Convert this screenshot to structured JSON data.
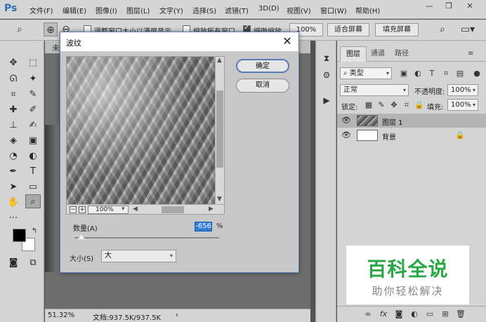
{
  "app": {
    "logo": "Ps",
    "menu": [
      "文件(F)",
      "编辑(E)",
      "图像(I)",
      "图层(L)",
      "文字(Y)",
      "选择(S)",
      "滤镜(T)",
      "3D(D)",
      "视图(V)",
      "窗口(W)",
      "帮助(H)"
    ],
    "window_controls": [
      "—",
      "❐",
      "✕"
    ]
  },
  "options_bar": {
    "resize_windows_label": "调整窗口大小以满屏显示",
    "zoom_all_label": "缩放所有窗口",
    "scrubby_zoom_label": "细微缩放",
    "zoom_value": "100%",
    "fit_screen": "适合屏幕",
    "fill_screen": "填充屏幕",
    "checks": {
      "resize_windows": false,
      "zoom_all": false,
      "scrubby_zoom": true
    }
  },
  "document": {
    "tab_label": "未",
    "zoom": "51.32%",
    "doc_size": "文档:937.5K/937.5K",
    "arrow": "›"
  },
  "dialog": {
    "title": "波纹",
    "close": "✕",
    "ok": "确定",
    "cancel": "取消",
    "preview_zoom": "100%",
    "amount_label": "数量(A)",
    "amount_value": "-656",
    "percent": "%",
    "size_label": "大小(S)",
    "size_value": "大",
    "amount_slider_fraction": 0.05
  },
  "layers_panel": {
    "tabs": [
      "图层",
      "通道",
      "路径"
    ],
    "filter_type": "类型",
    "blend_mode": "正常",
    "opacity_label": "不透明度:",
    "opacity": "100%",
    "lock_label": "锁定:",
    "fill_label": "填充:",
    "fill": "100%",
    "layers": [
      {
        "name": "图层 1",
        "selected": true,
        "locked": false
      },
      {
        "name": "背景",
        "selected": false,
        "locked": true
      }
    ],
    "footer_icons": [
      "link-icon",
      "fx-icon",
      "mask-icon",
      "adjustment-icon",
      "group-icon",
      "new-layer-icon",
      "trash-icon"
    ]
  },
  "watermark": {
    "title": "百科全说",
    "subtitle": "助你轻松解决"
  },
  "colors": {
    "accent": "#2f7bd6",
    "watermark_green": "#2aa846",
    "foreground": "#000000",
    "background": "#ffffff"
  }
}
